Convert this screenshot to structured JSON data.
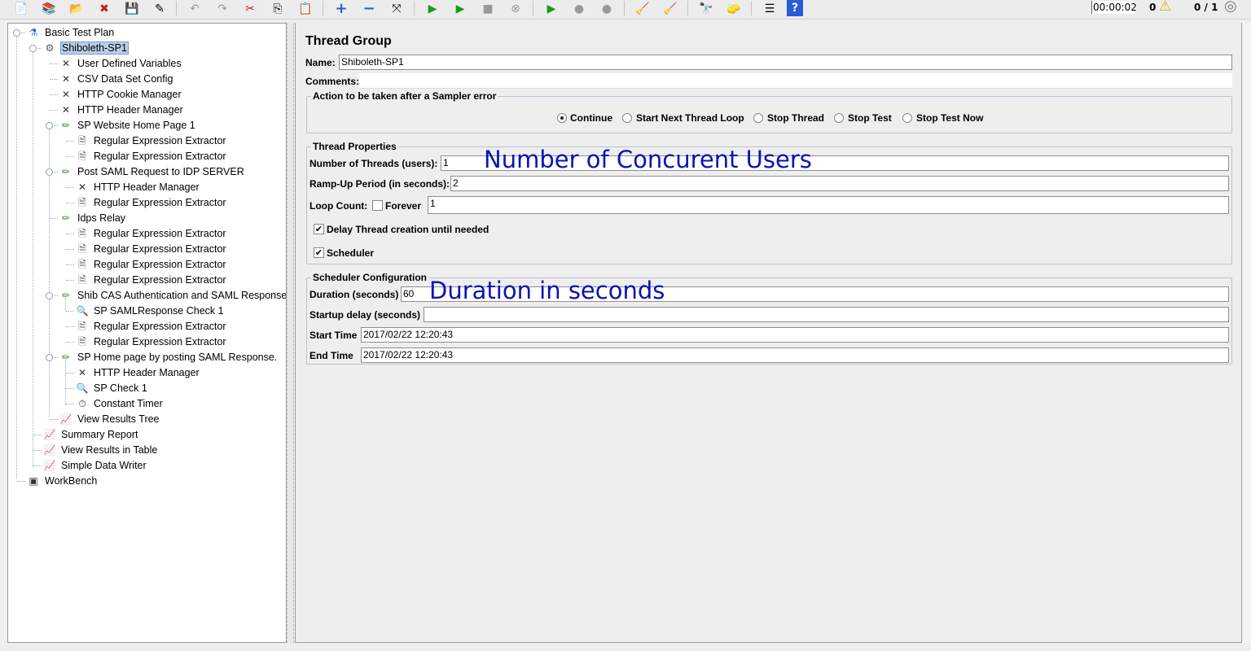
{
  "toolbar": {
    "buttons": [
      {
        "name": "new-icon",
        "glyph": "📄",
        "disabled": false
      },
      {
        "name": "templates-icon",
        "glyph": "📚",
        "disabled": false
      },
      {
        "name": "open-icon",
        "glyph": "📂",
        "disabled": false
      },
      {
        "name": "close-icon",
        "glyph": "✖",
        "disabled": false
      },
      {
        "name": "save-icon",
        "glyph": "💾",
        "disabled": false
      },
      {
        "name": "save-as-icon",
        "glyph": "✎",
        "disabled": false
      },
      {
        "name": "undo-icon",
        "glyph": "↶",
        "disabled": true
      },
      {
        "name": "redo-icon",
        "glyph": "↷",
        "disabled": true
      },
      {
        "name": "cut-icon",
        "glyph": "✂",
        "disabled": false
      },
      {
        "name": "copy-icon",
        "glyph": "⎘",
        "disabled": false
      },
      {
        "name": "paste-icon",
        "glyph": "📋",
        "disabled": false
      },
      {
        "name": "expand-all-icon",
        "glyph": "+",
        "disabled": false
      },
      {
        "name": "collapse-all-icon",
        "glyph": "−",
        "disabled": false
      },
      {
        "name": "toggle-icon",
        "glyph": "⤧",
        "disabled": false
      },
      {
        "name": "start-icon",
        "glyph": "▶",
        "disabled": false
      },
      {
        "name": "start-no-pauses-icon",
        "glyph": "▶",
        "disabled": false
      },
      {
        "name": "stop-icon",
        "glyph": "■",
        "disabled": true
      },
      {
        "name": "shutdown-icon",
        "glyph": "⊗",
        "disabled": true
      },
      {
        "name": "remote-start-icon",
        "glyph": "▶",
        "disabled": false
      },
      {
        "name": "remote-stop-icon",
        "glyph": "●",
        "disabled": true
      },
      {
        "name": "remote-shutdown-icon",
        "glyph": "●",
        "disabled": true
      },
      {
        "name": "clear-icon",
        "glyph": "🧹",
        "disabled": false
      },
      {
        "name": "clear-all-icon",
        "glyph": "🧹",
        "disabled": false
      },
      {
        "name": "search-icon",
        "glyph": "🔭",
        "disabled": false
      },
      {
        "name": "reset-search-icon",
        "glyph": "🧽",
        "disabled": false
      },
      {
        "name": "function-helper-icon",
        "glyph": "☰",
        "disabled": false
      },
      {
        "name": "help-icon",
        "glyph": "?",
        "disabled": false
      }
    ]
  },
  "status": {
    "timer": "00:00:02",
    "errors": "0",
    "threads": "0 / 1"
  },
  "tree": [
    {
      "label": "Basic Test Plan",
      "icon": "test-plan-icon",
      "glyph": "⚗",
      "color": "#2a5bd7"
    },
    {
      "label": "Shiboleth-SP1",
      "icon": "thread-group-icon",
      "glyph": "⚙",
      "color": "#555"
    },
    {
      "label": "User Defined Variables",
      "icon": "config-element-icon",
      "glyph": "✕",
      "color": "#333"
    },
    {
      "label": "CSV Data Set Config",
      "icon": "config-element-icon",
      "glyph": "✕",
      "color": "#333"
    },
    {
      "label": "HTTP Cookie Manager",
      "icon": "config-element-icon",
      "glyph": "✕",
      "color": "#333"
    },
    {
      "label": "HTTP Header Manager",
      "icon": "config-element-icon",
      "glyph": "✕",
      "color": "#333"
    },
    {
      "label": "SP Website Home Page 1",
      "icon": "sampler-icon",
      "glyph": "✏",
      "color": "#3a8a2a"
    },
    {
      "label": "Regular Expression Extractor",
      "icon": "post-processor-icon",
      "glyph": "🗎",
      "color": "#555"
    },
    {
      "label": "Regular Expression Extractor",
      "icon": "post-processor-icon",
      "glyph": "🗎",
      "color": "#555"
    },
    {
      "label": "Post SAML Request to IDP SERVER",
      "icon": "sampler-icon",
      "glyph": "✏",
      "color": "#3a8a2a"
    },
    {
      "label": "HTTP Header Manager",
      "icon": "config-element-icon",
      "glyph": "✕",
      "color": "#333"
    },
    {
      "label": "Regular Expression Extractor",
      "icon": "post-processor-icon",
      "glyph": "🗎",
      "color": "#555"
    },
    {
      "label": "Idps Relay",
      "icon": "sampler-icon",
      "glyph": "✏",
      "color": "#3a8a2a"
    },
    {
      "label": "Regular Expression Extractor",
      "icon": "post-processor-icon",
      "glyph": "🗎",
      "color": "#555"
    },
    {
      "label": "Regular Expression Extractor",
      "icon": "post-processor-icon",
      "glyph": "🗎",
      "color": "#555"
    },
    {
      "label": "Regular Expression Extractor",
      "icon": "post-processor-icon",
      "glyph": "🗎",
      "color": "#555"
    },
    {
      "label": "Regular Expression Extractor",
      "icon": "post-processor-icon",
      "glyph": "🗎",
      "color": "#555"
    },
    {
      "label": "Shib CAS Authentication and SAML Response",
      "icon": "sampler-icon",
      "glyph": "✏",
      "color": "#3a8a2a"
    },
    {
      "label": "SP SAMLResponse Check 1",
      "icon": "assertion-icon",
      "glyph": "🔍",
      "color": "#2a5bd7"
    },
    {
      "label": "Regular Expression Extractor",
      "icon": "post-processor-icon",
      "glyph": "🗎",
      "color": "#555"
    },
    {
      "label": "Regular Expression Extractor",
      "icon": "post-processor-icon",
      "glyph": "🗎",
      "color": "#555"
    },
    {
      "label": "SP Home page by posting SAML Response.",
      "icon": "sampler-icon",
      "glyph": "✏",
      "color": "#3a8a2a"
    },
    {
      "label": "HTTP Header Manager",
      "icon": "config-element-icon",
      "glyph": "✕",
      "color": "#333"
    },
    {
      "label": "SP Check 1",
      "icon": "assertion-icon",
      "glyph": "🔍",
      "color": "#2a5bd7"
    },
    {
      "label": "Constant Timer",
      "icon": "timer-icon",
      "glyph": "⏱",
      "color": "#333"
    },
    {
      "label": "View Results Tree",
      "icon": "listener-icon",
      "glyph": "📈",
      "color": "#c03090"
    },
    {
      "label": "Summary Report",
      "icon": "listener-icon",
      "glyph": "📈",
      "color": "#c03090"
    },
    {
      "label": "View Results in Table",
      "icon": "listener-icon",
      "glyph": "📈",
      "color": "#c03090"
    },
    {
      "label": "Simple Data Writer",
      "icon": "listener-icon",
      "glyph": "📈",
      "color": "#c03090"
    },
    {
      "label": "WorkBench",
      "icon": "workbench-icon",
      "glyph": "▣",
      "color": "#333"
    }
  ],
  "panel": {
    "title": "Thread Group",
    "name_label": "Name:",
    "name_value": "Shiboleth-SP1",
    "comments_label": "Comments:",
    "comments_value": "",
    "action": {
      "title": "Action to be taken after a Sampler error",
      "options": [
        "Continue",
        "Start Next Thread Loop",
        "Stop Thread",
        "Stop Test",
        "Stop Test Now"
      ],
      "selected": "Continue"
    },
    "thread_props": {
      "title": "Thread Properties",
      "threads_label": "Number of Threads (users):",
      "threads_value": "1",
      "rampup_label": "Ramp-Up Period (in seconds):",
      "rampup_value": "2",
      "loop_label": "Loop Count:",
      "forever_label": "Forever",
      "forever_checked": false,
      "loop_value": "1",
      "delay_label": "Delay Thread creation until needed",
      "delay_checked": true,
      "scheduler_label": "Scheduler",
      "scheduler_checked": true
    },
    "scheduler": {
      "title": "Scheduler Configuration",
      "duration_label": "Duration (seconds)",
      "duration_value": "60",
      "startup_label": "Startup delay (seconds)",
      "startup_value": "",
      "start_label": "Start Time",
      "start_value": "2017/02/22 12:20:43",
      "end_label": "End Time",
      "end_value": "2017/02/22 12:20:43"
    }
  },
  "annotations": {
    "users": "Number of Concurent Users",
    "duration": "Duration in seconds"
  },
  "colors": {
    "annotation": "#0a14b4",
    "selection": "#b8cfe5"
  }
}
